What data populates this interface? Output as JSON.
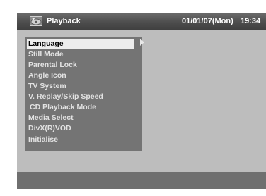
{
  "header": {
    "icon": "disc-playback-icon",
    "title": "Playback",
    "date": "01/01/07(Mon)",
    "time": "19:34"
  },
  "menu": {
    "items": [
      {
        "label": "Language",
        "selected": true
      },
      {
        "label": "Still Mode"
      },
      {
        "label": "Parental Lock"
      },
      {
        "label": "Angle Icon"
      },
      {
        "label": "TV System"
      },
      {
        "label": "V. Replay/Skip Speed"
      },
      {
        "label": "CD Playback Mode"
      },
      {
        "label": "Media Select"
      },
      {
        "label": "DivX(R)VOD"
      },
      {
        "label": "Initialise"
      }
    ],
    "submenu_indicator": "right-arrow-icon"
  },
  "colors": {
    "screen_bg": "#bdbdbd",
    "header_bg": "#4d4d4d",
    "menu_bg": "#747474",
    "selected_bg": "#ededed",
    "footer_bg": "#6f6f6f"
  }
}
